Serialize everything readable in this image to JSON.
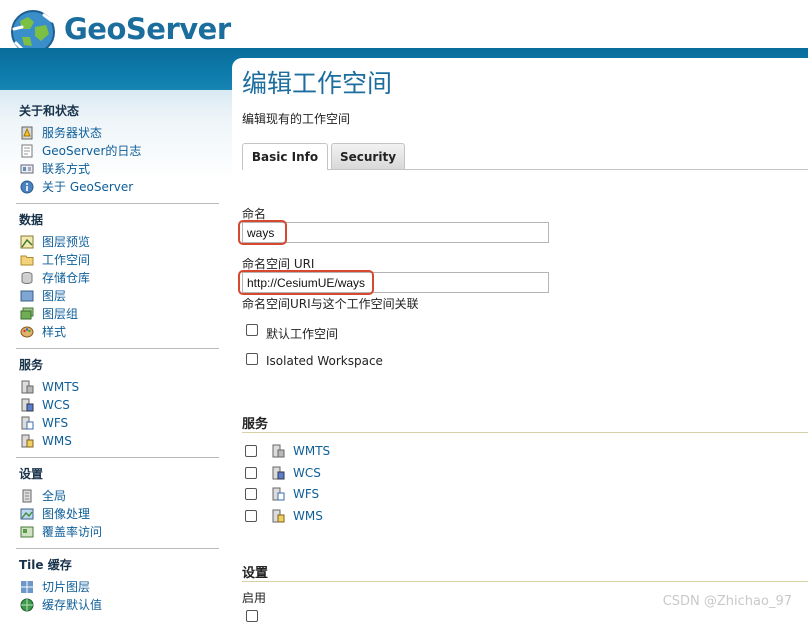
{
  "app": {
    "logo_text": "GeoServer"
  },
  "sidebar": {
    "sections": [
      {
        "title": "关于和状态",
        "items": [
          {
            "label": "服务器状态",
            "icon": "server-status-icon"
          },
          {
            "label": "GeoServer的日志",
            "icon": "log-document-icon"
          },
          {
            "label": "联系方式",
            "icon": "contact-card-icon"
          },
          {
            "label": "关于 GeoServer",
            "icon": "info-icon"
          }
        ]
      },
      {
        "title": "数据",
        "items": [
          {
            "label": "图层预览",
            "icon": "layer-preview-icon"
          },
          {
            "label": "工作空间",
            "icon": "folder-icon"
          },
          {
            "label": "存储仓库",
            "icon": "store-icon"
          },
          {
            "label": "图层",
            "icon": "layer-icon"
          },
          {
            "label": "图层组",
            "icon": "layer-group-icon"
          },
          {
            "label": "样式",
            "icon": "palette-icon"
          }
        ]
      },
      {
        "title": "服务",
        "items": [
          {
            "label": "WMTS",
            "icon": "wmts-icon"
          },
          {
            "label": "WCS",
            "icon": "wcs-icon"
          },
          {
            "label": "WFS",
            "icon": "wfs-icon"
          },
          {
            "label": "WMS",
            "icon": "wms-icon"
          }
        ]
      },
      {
        "title": "设置",
        "items": [
          {
            "label": "全局",
            "icon": "global-settings-icon"
          },
          {
            "label": "图像处理",
            "icon": "image-processing-icon"
          },
          {
            "label": "覆盖率访问",
            "icon": "coverage-access-icon"
          }
        ]
      },
      {
        "title": "Tile 缓存",
        "items": [
          {
            "label": "切片图层",
            "icon": "tile-layers-icon"
          },
          {
            "label": "缓存默认值",
            "icon": "globe-icon"
          }
        ]
      }
    ]
  },
  "main": {
    "title": "编辑工作空间",
    "subtitle": "编辑现有的工作空间",
    "tabs": [
      {
        "label": "Basic Info",
        "active": true
      },
      {
        "label": "Security",
        "active": false
      }
    ],
    "name_label": "命名",
    "name_value": "ways",
    "uri_label": "命名空间 URI",
    "uri_value": "http://CesiumUE/ways",
    "uri_help": "命名空间URI与这个工作空间关联",
    "default_ws_label": "默认工作空间",
    "isolated_ws_label": "Isolated Workspace",
    "services_heading": "服务",
    "services": [
      {
        "label": "WMTS",
        "icon": "wmts-icon"
      },
      {
        "label": "WCS",
        "icon": "wcs-icon"
      },
      {
        "label": "WFS",
        "icon": "wfs-icon"
      },
      {
        "label": "WMS",
        "icon": "wms-icon"
      }
    ],
    "settings_heading": "设置",
    "enabled_label": "启用"
  },
  "watermark": "CSDN @Zhichao_97",
  "colors": {
    "header_band": "#0d7bab",
    "link": "#0e5e98",
    "title": "#1d6e9e",
    "highlight": "#d6482f"
  }
}
